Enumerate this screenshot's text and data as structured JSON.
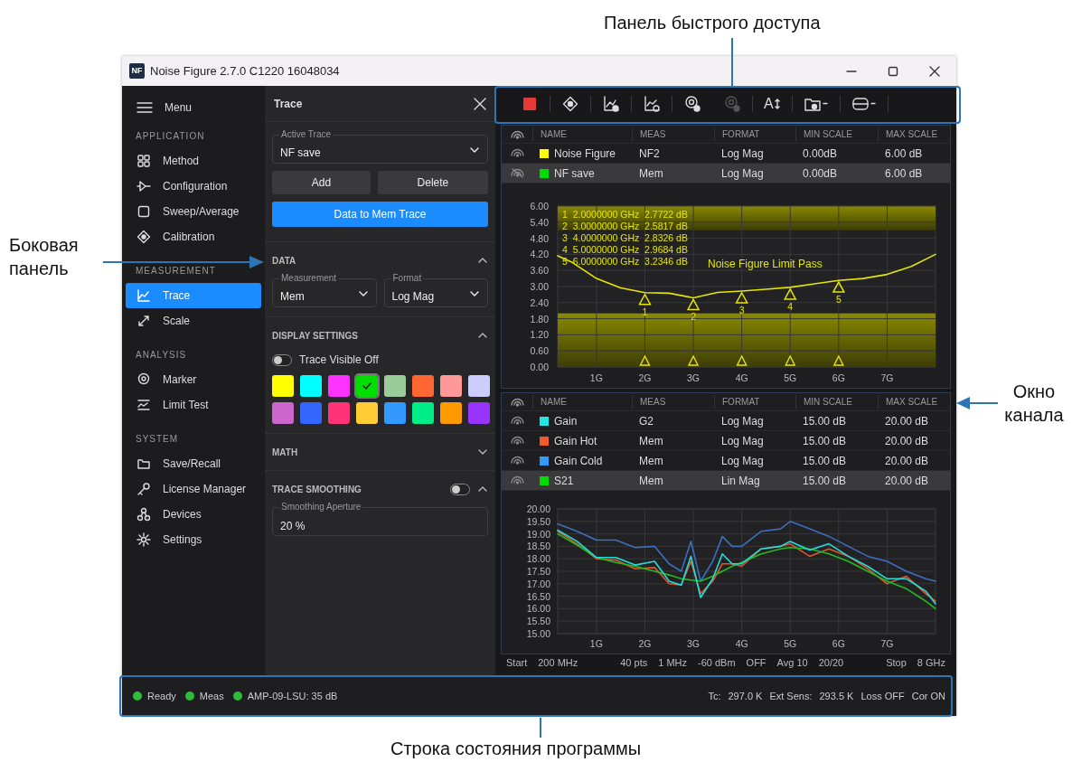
{
  "callouts": [
    {
      "kind": "top",
      "text": "Панель быстрого доступа"
    },
    {
      "kind": "left",
      "text": "Боковая панель"
    },
    {
      "kind": "right",
      "text": "Окно канала"
    },
    {
      "kind": "bottom",
      "text": "Строка состояния программы"
    }
  ],
  "window": {
    "logo": "NF",
    "title": "Noise Figure 2.7.0 C1220 16048034"
  },
  "sidebar": {
    "menu_label": "Menu",
    "sections": [
      {
        "title": "APPLICATION",
        "items": [
          {
            "label": "Method",
            "selected": false
          },
          {
            "label": "Configuration",
            "selected": false
          },
          {
            "label": "Sweep/Average",
            "selected": false
          },
          {
            "label": "Calibration",
            "selected": false
          }
        ]
      },
      {
        "title": "MEASUREMENT",
        "items": [
          {
            "label": "Trace",
            "selected": true
          },
          {
            "label": "Scale",
            "selected": false
          }
        ]
      },
      {
        "title": "ANALYSIS",
        "items": [
          {
            "label": "Marker",
            "selected": false
          },
          {
            "label": "Limit Test",
            "selected": false
          }
        ]
      },
      {
        "title": "SYSTEM",
        "items": [
          {
            "label": "Save/Recall",
            "selected": false
          },
          {
            "label": "License Manager",
            "selected": false
          },
          {
            "label": "Devices",
            "selected": false
          },
          {
            "label": "Settings",
            "selected": false
          }
        ]
      }
    ]
  },
  "trace_panel": {
    "title": "Trace",
    "active_trace": {
      "label": "Active Trace",
      "value": "NF save"
    },
    "buttons": [
      {
        "label": "Add",
        "kind": "secondary"
      },
      {
        "label": "Delete",
        "kind": "secondary"
      },
      {
        "label": "Data to Mem Trace",
        "kind": "primary"
      }
    ],
    "sections": [
      {
        "kind": "selects",
        "title": "DATA",
        "expanded": true,
        "fields": [
          {
            "label": "Measurement",
            "value": "Mem"
          },
          {
            "label": "Format",
            "value": "Log Mag"
          }
        ]
      },
      {
        "kind": "display",
        "title": "DISPLAY SETTINGS",
        "expanded": true,
        "toggle": {
          "label": "Trace Visible Off",
          "on": false
        },
        "swatches": [
          {
            "color": "#ffff00",
            "selected": false
          },
          {
            "color": "#00ffff",
            "selected": false
          },
          {
            "color": "#ff33ff",
            "selected": false
          },
          {
            "color": "#00dd00",
            "selected": true
          },
          {
            "color": "#99cc99",
            "selected": false
          },
          {
            "color": "#ff6633",
            "selected": false
          },
          {
            "color": "#ff9999",
            "selected": false
          },
          {
            "color": "#ccccff",
            "selected": false
          },
          {
            "color": "#cc66cc",
            "selected": false
          },
          {
            "color": "#3366ff",
            "selected": false
          },
          {
            "color": "#ff3377",
            "selected": false
          },
          {
            "color": "#ffcc33",
            "selected": false
          },
          {
            "color": "#3399ff",
            "selected": false
          },
          {
            "color": "#00ee88",
            "selected": false
          },
          {
            "color": "#ff9900",
            "selected": false
          },
          {
            "color": "#9933ff",
            "selected": false
          }
        ]
      },
      {
        "kind": "plain",
        "title": "MATH",
        "expanded": false
      },
      {
        "kind": "smoothing",
        "title": "TRACE SMOOTHING",
        "expanded": true,
        "on": false,
        "field": {
          "label": "Smoothing Aperture",
          "value": "20 %"
        }
      }
    ]
  },
  "toolbar": [
    {
      "kind": "stop",
      "disabled": false
    },
    {
      "kind": "target",
      "disabled": false
    },
    {
      "kind": "chart_add",
      "disabled": false
    },
    {
      "kind": "chart_gear",
      "disabled": false
    },
    {
      "kind": "pin",
      "disabled": false
    },
    {
      "kind": "pin",
      "disabled": true
    },
    {
      "kind": "text_size",
      "label": "A",
      "disabled": false
    },
    {
      "kind": "folder",
      "dropdown": true,
      "disabled": false
    },
    {
      "kind": "layout",
      "dropdown": true,
      "disabled": false
    }
  ],
  "channels": [
    {
      "columns": [
        "NAME",
        "MEAS",
        "FORMAT",
        "MIN SCALE",
        "MAX SCALE"
      ],
      "traces": [
        {
          "visible": true,
          "color": "#ffff00",
          "name": "Noise Figure",
          "meas": "NF2",
          "format": "Log Mag",
          "min_scale": "0.00dB",
          "max_scale": "6.00 dB",
          "selected": false
        },
        {
          "visible": false,
          "color": "#00dd00",
          "name": "NF save",
          "meas": "Mem",
          "format": "Log Mag",
          "min_scale": "0.00dB",
          "max_scale": "6.00 dB",
          "selected": true
        }
      ],
      "marker_readouts": [
        "1  2.0000000 GHz  2.7722 dB",
        "2  3.0000000 GHz  2.5817 dB",
        "3  4.0000000 GHz  2.8326 dB",
        "4  5.0000000 GHz  2.9684 dB",
        "5  6.0000000 GHz  3.2346 dB"
      ],
      "limit_text": "Noise Figure Limit Pass",
      "chart_data": {
        "type": "line",
        "x": [
          0.2,
          0.5,
          1,
          1.5,
          2,
          2.5,
          3,
          3.5,
          4,
          4.5,
          5,
          5.5,
          6,
          6.5,
          7,
          7.5,
          8
        ],
        "xlim": [
          0.2,
          8
        ],
        "ylim": [
          0,
          6
        ],
        "xticks": [
          {
            "value": 1,
            "label": "1G"
          },
          {
            "value": 2,
            "label": "2G"
          },
          {
            "value": 3,
            "label": "3G"
          },
          {
            "value": 4,
            "label": "4G"
          },
          {
            "value": 5,
            "label": "5G"
          },
          {
            "value": 6,
            "label": "6G"
          },
          {
            "value": 7,
            "label": "7G"
          }
        ],
        "yticks": [
          {
            "value": 0,
            "label": "0.00"
          },
          {
            "value": 0.6,
            "label": "0.60"
          },
          {
            "value": 1.2,
            "label": "1.20"
          },
          {
            "value": 1.8,
            "label": "1.80"
          },
          {
            "value": 2.4,
            "label": "2.40"
          },
          {
            "value": 3,
            "label": "3.00"
          },
          {
            "value": 3.6,
            "label": "3.60"
          },
          {
            "value": 4.2,
            "label": "4.20"
          },
          {
            "value": 4.8,
            "label": "4.80"
          },
          {
            "value": 5.4,
            "label": "5.40"
          },
          {
            "value": 6,
            "label": "6.00"
          }
        ],
        "series": [
          {
            "color": "#e6e600",
            "values": [
              4.15,
              3.9,
              3.3,
              2.95,
              2.77,
              2.75,
              2.58,
              2.78,
              2.83,
              2.9,
              2.97,
              3.1,
              3.23,
              3.3,
              3.45,
              3.75,
              4.2
            ]
          }
        ],
        "grid": true,
        "bands": [
          {
            "axis": "y",
            "from": 5.1,
            "to": 6
          },
          {
            "axis": "y",
            "from": 0,
            "to": 2
          }
        ],
        "annotations": [
          {
            "text": "1",
            "x": 2,
            "y": 2.7722
          },
          {
            "text": "2",
            "x": 3,
            "y": 2.5817
          },
          {
            "text": "3",
            "x": 4,
            "y": 2.8326
          },
          {
            "text": "4",
            "x": 5,
            "y": 2.9684
          },
          {
            "text": "5",
            "x": 6,
            "y": 3.2346
          }
        ]
      }
    },
    {
      "columns": [
        "NAME",
        "MEAS",
        "FORMAT",
        "MIN SCALE",
        "MAX SCALE"
      ],
      "traces": [
        {
          "visible": true,
          "color": "#22e5e5",
          "name": "Gain",
          "meas": "G2",
          "format": "Log Mag",
          "min_scale": "15.00 dB",
          "max_scale": "20.00 dB",
          "selected": false
        },
        {
          "visible": true,
          "color": "#ee5a2a",
          "name": "Gain Hot",
          "meas": "Mem",
          "format": "Log Mag",
          "min_scale": "15.00 dB",
          "max_scale": "20.00 dB",
          "selected": false
        },
        {
          "visible": true,
          "color": "#3399ff",
          "name": "Gain Cold",
          "meas": "Mem",
          "format": "Log Mag",
          "min_scale": "15.00 dB",
          "max_scale": "20.00 dB",
          "selected": false
        },
        {
          "visible": true,
          "color": "#00dd00",
          "name": "S21",
          "meas": "Mem",
          "format": "Lin Mag",
          "min_scale": "15.00 dB",
          "max_scale": "20.00 dB",
          "selected": true
        }
      ],
      "chart_data": {
        "type": "line",
        "grid": true,
        "x": [
          0.2,
          0.6,
          1.0,
          1.4,
          1.8,
          2.2,
          2.5,
          2.75,
          2.95,
          3.15,
          3.4,
          3.6,
          3.8,
          4.0,
          4.4,
          4.8,
          5.0,
          5.4,
          5.8,
          6.2,
          6.6,
          7.0,
          7.4,
          7.8,
          8.0
        ],
        "xlim": [
          0.2,
          8
        ],
        "ylim": [
          15,
          20
        ],
        "xticks": [
          {
            "value": 1,
            "label": "1G"
          },
          {
            "value": 2,
            "label": "2G"
          },
          {
            "value": 3,
            "label": "3G"
          },
          {
            "value": 4,
            "label": "4G"
          },
          {
            "value": 5,
            "label": "5G"
          },
          {
            "value": 6,
            "label": "6G"
          },
          {
            "value": 7,
            "label": "7G"
          }
        ],
        "yticks": [
          {
            "value": 15,
            "label": "15.00"
          },
          {
            "value": 15.5,
            "label": "15.50"
          },
          {
            "value": 16,
            "label": "16.00"
          },
          {
            "value": 16.5,
            "label": "16.50"
          },
          {
            "value": 17,
            "label": "17.00"
          },
          {
            "value": 17.5,
            "label": "17.50"
          },
          {
            "value": 18,
            "label": "18.00"
          },
          {
            "value": 18.5,
            "label": "18.50"
          },
          {
            "value": 19,
            "label": "19.00"
          },
          {
            "value": 19.5,
            "label": "19.50"
          },
          {
            "value": 20,
            "label": "20.00"
          }
        ],
        "series": [
          {
            "color": "#3b6fc0",
            "values": [
              19.4,
              19.1,
              18.75,
              18.75,
              18.45,
              18.5,
              17.8,
              17.5,
              18.7,
              17.1,
              17.9,
              18.9,
              18.5,
              18.5,
              19.1,
              19.2,
              19.5,
              19.2,
              18.9,
              18.5,
              18.1,
              17.9,
              17.5,
              17.2,
              17.1
            ]
          },
          {
            "color": "#e0552a",
            "values": [
              19.1,
              18.6,
              18.0,
              17.95,
              17.6,
              17.65,
              17.0,
              16.95,
              17.9,
              16.6,
              17.1,
              17.8,
              17.8,
              17.7,
              18.4,
              18.5,
              18.6,
              18.1,
              18.4,
              18.1,
              17.6,
              17.0,
              17.3,
              16.6,
              16.3
            ]
          },
          {
            "color": "#22bb22",
            "values": [
              19.0,
              18.55,
              18.05,
              17.85,
              17.7,
              17.5,
              17.35,
              17.2,
              17.15,
              17.1,
              17.3,
              17.5,
              17.7,
              17.85,
              18.2,
              18.4,
              18.45,
              18.4,
              18.2,
              17.9,
              17.5,
              17.1,
              16.8,
              16.3,
              16.0
            ]
          },
          {
            "color": "#22dddd",
            "values": [
              19.15,
              18.7,
              18.05,
              18.05,
              17.75,
              17.9,
              17.1,
              16.95,
              18.1,
              16.45,
              17.2,
              18.2,
              17.8,
              17.8,
              18.4,
              18.5,
              18.7,
              18.35,
              18.6,
              18.1,
              17.7,
              17.2,
              17.2,
              16.7,
              16.2
            ]
          }
        ]
      },
      "footer": {
        "start": [
          "Start",
          "200 MHz"
        ],
        "middle": [
          "40 pts",
          "1 MHz",
          "-60 dBm",
          "OFF",
          "Avg 10",
          "20/20"
        ],
        "stop": [
          "Stop",
          "8 GHz"
        ]
      }
    }
  ],
  "status_bar": {
    "indicators": [
      "Ready",
      "Meas",
      "AMP-09-LSU: 35 dB"
    ],
    "readouts": [
      "Tc:",
      "297.0 K",
      "Ext Sens:",
      "293.5 K",
      "Loss OFF",
      "Cor ON"
    ]
  }
}
